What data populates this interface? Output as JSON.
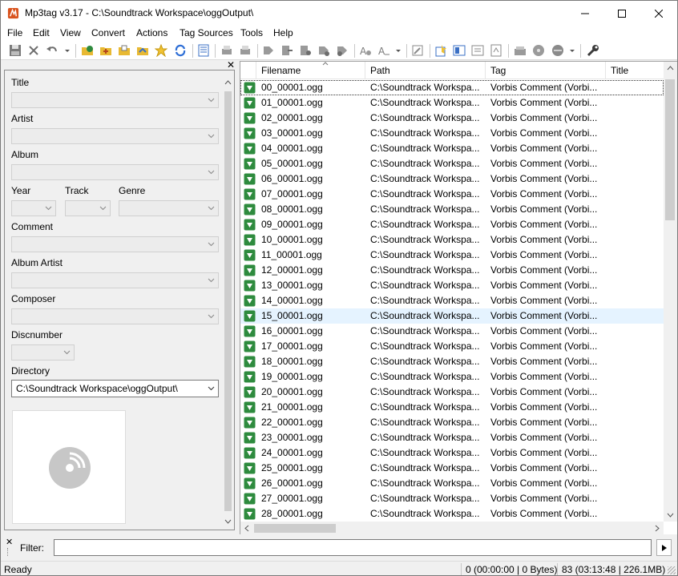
{
  "window": {
    "title": "Mp3tag v3.17  -  C:\\Soundtrack Workspace\\oggOutput\\"
  },
  "menu": [
    "File",
    "Edit",
    "View",
    "Convert",
    "Actions",
    "Tag Sources",
    "Tools",
    "Help"
  ],
  "toolbar_icons": [
    "save-icon",
    "remove-tag-icon",
    "undo-icon",
    "dropdown-icon",
    "change-directory-icon",
    "add-directory-icon",
    "open-folder-icon",
    "save-playlist-icon",
    "favorites-icon",
    "refresh-icon",
    "tag-panel-icon",
    "tag-to-filename-icon",
    "filename-to-tag-icon",
    "filename-to-filename-icon",
    "tag-to-tag-icon",
    "text-file-to-tag-icon",
    "actions-icon",
    "actions-quick-icon",
    "dropdown-icon",
    "autonumber-icon",
    "export-icon",
    "playlist-icon",
    "batch-icon",
    "convert-icon",
    "freedb-icon",
    "musicbrainz-icon",
    "tag-sources-icon",
    "dropdown-icon",
    "options-icon"
  ],
  "tag_panel": {
    "title_label": "Title",
    "artist_label": "Artist",
    "album_label": "Album",
    "year_label": "Year",
    "track_label": "Track",
    "genre_label": "Genre",
    "comment_label": "Comment",
    "album_artist_label": "Album Artist",
    "composer_label": "Composer",
    "discnumber_label": "Discnumber",
    "directory_label": "Directory",
    "directory_value": "C:\\Soundtrack Workspace\\oggOutput\\"
  },
  "columns": [
    "Filename",
    "Path",
    "Tag",
    "Title"
  ],
  "files": [
    {
      "filename": "00_00001.ogg",
      "path": "C:\\Soundtrack Workspa...",
      "tag": "Vorbis Comment (Vorbi..."
    },
    {
      "filename": "01_00001.ogg",
      "path": "C:\\Soundtrack Workspa...",
      "tag": "Vorbis Comment (Vorbi..."
    },
    {
      "filename": "02_00001.ogg",
      "path": "C:\\Soundtrack Workspa...",
      "tag": "Vorbis Comment (Vorbi..."
    },
    {
      "filename": "03_00001.ogg",
      "path": "C:\\Soundtrack Workspa...",
      "tag": "Vorbis Comment (Vorbi..."
    },
    {
      "filename": "04_00001.ogg",
      "path": "C:\\Soundtrack Workspa...",
      "tag": "Vorbis Comment (Vorbi..."
    },
    {
      "filename": "05_00001.ogg",
      "path": "C:\\Soundtrack Workspa...",
      "tag": "Vorbis Comment (Vorbi..."
    },
    {
      "filename": "06_00001.ogg",
      "path": "C:\\Soundtrack Workspa...",
      "tag": "Vorbis Comment (Vorbi..."
    },
    {
      "filename": "07_00001.ogg",
      "path": "C:\\Soundtrack Workspa...",
      "tag": "Vorbis Comment (Vorbi..."
    },
    {
      "filename": "08_00001.ogg",
      "path": "C:\\Soundtrack Workspa...",
      "tag": "Vorbis Comment (Vorbi..."
    },
    {
      "filename": "09_00001.ogg",
      "path": "C:\\Soundtrack Workspa...",
      "tag": "Vorbis Comment (Vorbi..."
    },
    {
      "filename": "10_00001.ogg",
      "path": "C:\\Soundtrack Workspa...",
      "tag": "Vorbis Comment (Vorbi..."
    },
    {
      "filename": "11_00001.ogg",
      "path": "C:\\Soundtrack Workspa...",
      "tag": "Vorbis Comment (Vorbi..."
    },
    {
      "filename": "12_00001.ogg",
      "path": "C:\\Soundtrack Workspa...",
      "tag": "Vorbis Comment (Vorbi..."
    },
    {
      "filename": "13_00001.ogg",
      "path": "C:\\Soundtrack Workspa...",
      "tag": "Vorbis Comment (Vorbi..."
    },
    {
      "filename": "14_00001.ogg",
      "path": "C:\\Soundtrack Workspa...",
      "tag": "Vorbis Comment (Vorbi..."
    },
    {
      "filename": "15_00001.ogg",
      "path": "C:\\Soundtrack Workspa...",
      "tag": "Vorbis Comment (Vorbi..."
    },
    {
      "filename": "16_00001.ogg",
      "path": "C:\\Soundtrack Workspa...",
      "tag": "Vorbis Comment (Vorbi..."
    },
    {
      "filename": "17_00001.ogg",
      "path": "C:\\Soundtrack Workspa...",
      "tag": "Vorbis Comment (Vorbi..."
    },
    {
      "filename": "18_00001.ogg",
      "path": "C:\\Soundtrack Workspa...",
      "tag": "Vorbis Comment (Vorbi..."
    },
    {
      "filename": "19_00001.ogg",
      "path": "C:\\Soundtrack Workspa...",
      "tag": "Vorbis Comment (Vorbi..."
    },
    {
      "filename": "20_00001.ogg",
      "path": "C:\\Soundtrack Workspa...",
      "tag": "Vorbis Comment (Vorbi..."
    },
    {
      "filename": "21_00001.ogg",
      "path": "C:\\Soundtrack Workspa...",
      "tag": "Vorbis Comment (Vorbi..."
    },
    {
      "filename": "22_00001.ogg",
      "path": "C:\\Soundtrack Workspa...",
      "tag": "Vorbis Comment (Vorbi..."
    },
    {
      "filename": "23_00001.ogg",
      "path": "C:\\Soundtrack Workspa...",
      "tag": "Vorbis Comment (Vorbi..."
    },
    {
      "filename": "24_00001.ogg",
      "path": "C:\\Soundtrack Workspa...",
      "tag": "Vorbis Comment (Vorbi..."
    },
    {
      "filename": "25_00001.ogg",
      "path": "C:\\Soundtrack Workspa...",
      "tag": "Vorbis Comment (Vorbi..."
    },
    {
      "filename": "26_00001.ogg",
      "path": "C:\\Soundtrack Workspa...",
      "tag": "Vorbis Comment (Vorbi..."
    },
    {
      "filename": "27_00001.ogg",
      "path": "C:\\Soundtrack Workspa...",
      "tag": "Vorbis Comment (Vorbi..."
    },
    {
      "filename": "28_00001.ogg",
      "path": "C:\\Soundtrack Workspa...",
      "tag": "Vorbis Comment (Vorbi..."
    }
  ],
  "filter": {
    "label": "Filter:",
    "value": ""
  },
  "status": {
    "ready": "Ready",
    "selected": "0 (00:00:00 | 0 Bytes)",
    "total": "83 (03:13:48 | 226.1MB)"
  },
  "colors": {
    "accent_green": "#2e8b3e",
    "selected_row": "#e5f3ff",
    "titlebar": "#ffffff"
  }
}
